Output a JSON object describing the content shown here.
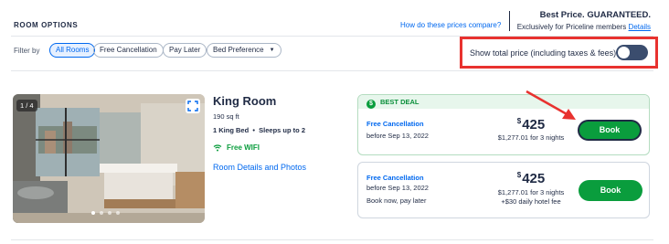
{
  "header": {
    "title": "ROOM OPTIONS",
    "compare_link": "How do these prices compare?",
    "best_price": "Best Price. GUARANTEED.",
    "exclusive_text": "Exclusively for Priceline members",
    "details_link": "Details"
  },
  "filters": {
    "label": "Filter by",
    "chips": [
      "All Rooms",
      "Free Cancellation",
      "Pay Later",
      "Bed Preference"
    ],
    "active": "All Rooms"
  },
  "toggle": {
    "label": "Show total price (including taxes & fees)",
    "state": "off"
  },
  "room": {
    "photo_counter": "1 / 4",
    "photo_dots": 4,
    "name": "King Room",
    "size": "190 sq ft",
    "bed": "1 King Bed",
    "sleeps": "Sleeps up to 2",
    "wifi": "Free WIFI",
    "details_link": "Room Details and Photos"
  },
  "rates": [
    {
      "badge": "BEST DEAL",
      "cancellation": "Free Cancellation",
      "cancel_by": "before Sep 13, 2022",
      "currency": "$",
      "price": "425",
      "total": "$1,277.01 for 3 nights",
      "button": "Book"
    },
    {
      "cancellation": "Free Cancellation",
      "cancel_by": "before Sep 13, 2022",
      "pay_later": "Book now, pay later",
      "currency": "$",
      "price": "425",
      "total": "$1,277.01 for 3 nights",
      "fee": "+$30 daily hotel fee",
      "button": "Book"
    }
  ],
  "colors": {
    "brand_blue": "#0068ef",
    "book_green": "#0a9d3d",
    "annotation_red": "#e8322f",
    "navy": "#1f2a44"
  }
}
